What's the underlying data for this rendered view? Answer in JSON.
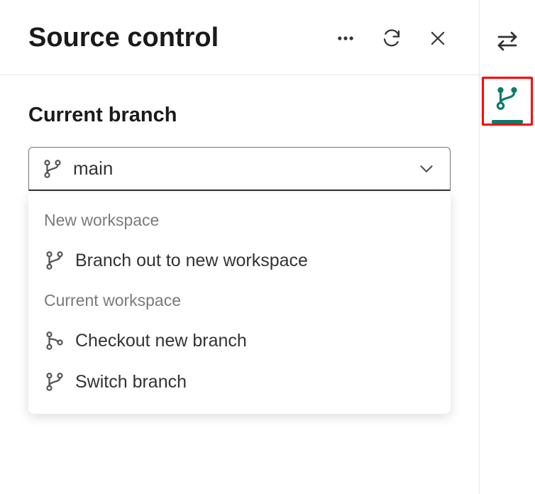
{
  "header": {
    "title": "Source control"
  },
  "section": {
    "label": "Current branch",
    "selected_branch": "main"
  },
  "dropdown": {
    "group1_label": "New workspace",
    "item_branch_out": "Branch out to new workspace",
    "group2_label": "Current workspace",
    "item_checkout": "Checkout new branch",
    "item_switch": "Switch branch"
  },
  "colors": {
    "accent": "#0b7a6b",
    "highlight": "#ff0000"
  }
}
